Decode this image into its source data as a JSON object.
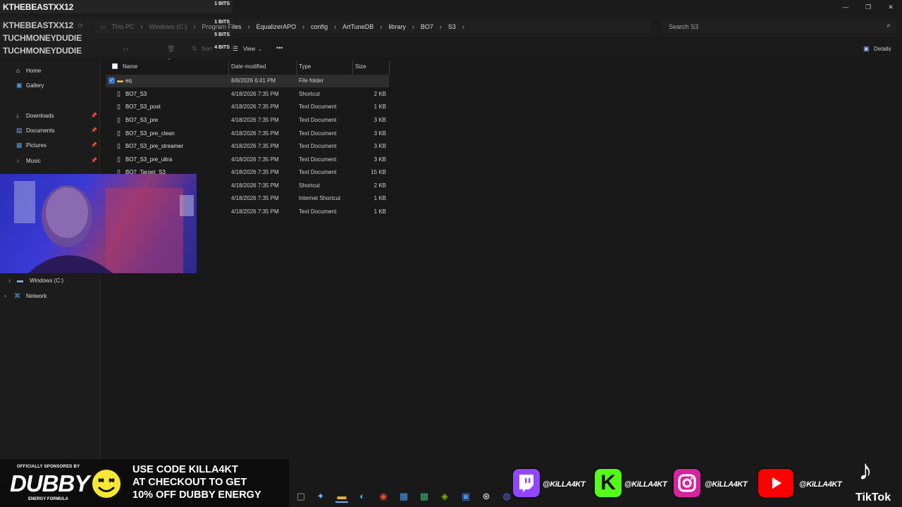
{
  "window": {
    "controls": [
      "—",
      "❐",
      "✕"
    ]
  },
  "address_bar": {
    "crumbs": [
      "This PC",
      "Windows (C:)",
      "Program Files",
      "EqualizerAPO",
      "config",
      "ArtTuneDB",
      "library",
      "BO7",
      "S3"
    ],
    "search_placeholder": "Search S3"
  },
  "toolbar": {
    "sort_label": "Sort",
    "view_label": "View",
    "more_label": "•••",
    "details_label": "Details"
  },
  "sidebar": {
    "items": [
      {
        "label": "Home",
        "icon": "home-icon",
        "pinned": false
      },
      {
        "label": "Gallery",
        "icon": "gallery-icon",
        "pinned": false
      },
      {
        "label": "Downloads",
        "icon": "download-icon",
        "pinned": true
      },
      {
        "label": "Documents",
        "icon": "document-icon",
        "pinned": true
      },
      {
        "label": "Pictures",
        "icon": "picture-icon",
        "pinned": true
      },
      {
        "label": "Music",
        "icon": "music-icon",
        "pinned": true
      }
    ],
    "drives": [
      {
        "label": "Windows (C:)",
        "icon": "drive-icon"
      },
      {
        "label": "Network",
        "icon": "network-icon"
      }
    ]
  },
  "file_list": {
    "columns": [
      "Name",
      "Date modified",
      "Type",
      "Size"
    ],
    "rows": [
      {
        "name": "eq",
        "date": "8/6/2026 6:41 PM",
        "type": "File folder",
        "size": "",
        "icon": "folder-icon",
        "selected": true
      },
      {
        "name": "BO7_S3",
        "date": "4/18/2026 7:35 PM",
        "type": "Shortcut",
        "size": "2 KB",
        "icon": "file-icon",
        "selected": false
      },
      {
        "name": "BO7_S3_post",
        "date": "4/18/2026 7:35 PM",
        "type": "Text Document",
        "size": "1 KB",
        "icon": "file-icon",
        "selected": false
      },
      {
        "name": "BO7_S3_pre",
        "date": "4/18/2026 7:35 PM",
        "type": "Text Document",
        "size": "3 KB",
        "icon": "file-icon",
        "selected": false
      },
      {
        "name": "BO7_S3_pre_clean",
        "date": "4/18/2026 7:35 PM",
        "type": "Text Document",
        "size": "3 KB",
        "icon": "file-icon",
        "selected": false
      },
      {
        "name": "BO7_S3_pre_streamer",
        "date": "4/18/2026 7:35 PM",
        "type": "Text Document",
        "size": "3 KB",
        "icon": "file-icon",
        "selected": false
      },
      {
        "name": "BO7_S3_pre_ultra",
        "date": "4/18/2026 7:35 PM",
        "type": "Text Document",
        "size": "3 KB",
        "icon": "file-icon",
        "selected": false
      },
      {
        "name": "BO7_Target_S3",
        "date": "4/18/2026 7:35 PM",
        "type": "Text Document",
        "size": "15 KB",
        "icon": "file-icon",
        "selected": false
      },
      {
        "name": "",
        "date": "4/18/2026 7:35 PM",
        "type": "Shortcut",
        "size": "2 KB",
        "icon": "file-icon",
        "selected": false
      },
      {
        "name": "",
        "date": "4/18/2026 7:35 PM",
        "type": "Internet Shortcut",
        "size": "1 KB",
        "icon": "file-icon",
        "selected": false
      },
      {
        "name": "",
        "date": "4/18/2026 7:35 PM",
        "type": "Text Document",
        "size": "1 KB",
        "icon": "file-icon",
        "selected": false
      }
    ]
  },
  "alerts": [
    {
      "name": "KTHEBEASTXX12",
      "amount": "1 BITS"
    },
    {
      "name": "KTHEBEASTXX12",
      "amount": "1 BITS"
    },
    {
      "name": "TUCHMONEYDUDIE",
      "amount": "5 BITS"
    },
    {
      "name": "TUCHMONEYDUDIE",
      "amount": "4 BITS"
    }
  ],
  "sponsor": {
    "small_text": "OFFICIALLY SPONSORED BY",
    "brand": "DUBBY",
    "brand_sub": "ENERGY FORMULA",
    "promo_lines": [
      "USE CODE KILLA4KT",
      "AT CHECKOUT TO GET",
      "10% OFF DUBBY ENERGY"
    ]
  },
  "socials": [
    {
      "platform": "twitch-icon",
      "handle": "@KiLLA4KT",
      "color": "#9146ff"
    },
    {
      "platform": "kick-icon",
      "handle": "@KiLLA4KT",
      "color": "#53fc18"
    },
    {
      "platform": "instagram-icon",
      "handle": "@KiLLA4KT",
      "color": "#d6249f"
    },
    {
      "platform": "youtube-icon",
      "handle": "@KiLLA4KT",
      "color": "#ff0000"
    }
  ],
  "tiktok": {
    "label": "TikTok"
  },
  "colors": {
    "accent": "#3a76c9",
    "background": "#191919",
    "selected_row": "#2e2e2e",
    "folder": "#e8b43a"
  }
}
